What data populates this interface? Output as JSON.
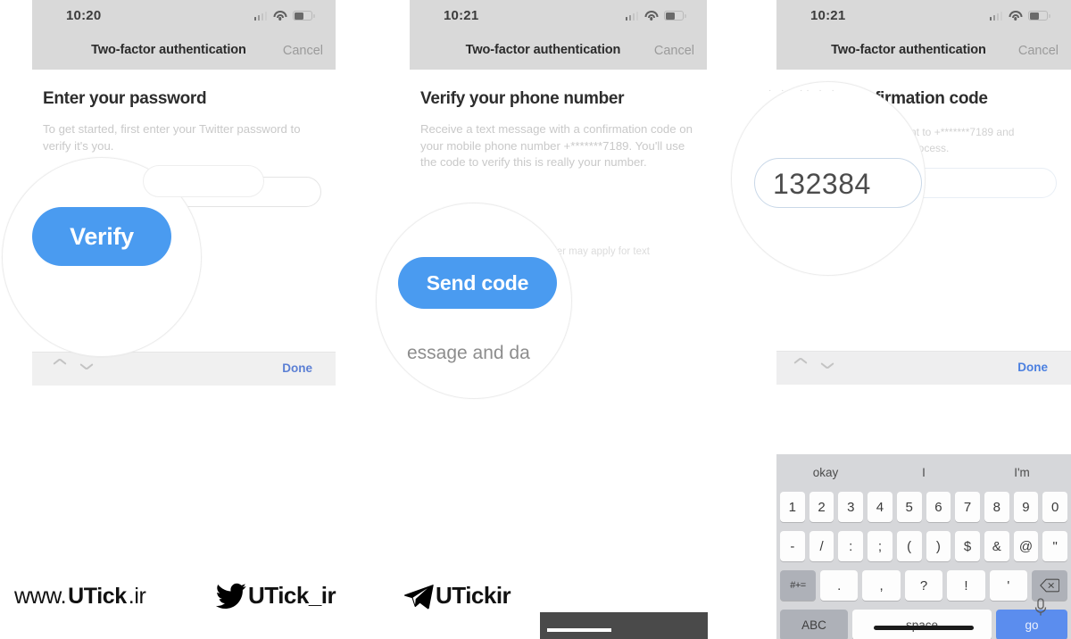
{
  "statusbar": {
    "time_p1": "10:20",
    "time_p2": "10:21",
    "time_p3": "10:21",
    "icons": [
      "signal-icon",
      "wifi-icon",
      "battery-icon"
    ]
  },
  "navbar": {
    "title": "Two-factor authentication",
    "cancel_label": "Cancel"
  },
  "panels": [
    {
      "id": "enter-password",
      "heading": "Enter your password",
      "body": "To get started, first enter your Twitter password to verify it's you.",
      "field_value": "",
      "accessory": {
        "done_label": "Done",
        "up_icon": "chevron-up-icon",
        "down_icon": "chevron-down-icon"
      },
      "magnifier": {
        "button_label": "Verify",
        "button_color": "#4a9bf0"
      }
    },
    {
      "id": "verify-phone",
      "heading": "Verify your phone number",
      "body": "Receive a text message with a confirmation code on your mobile phone number +*******7189. You'll use the code to verify this is really your number.",
      "fine_print": "Standard rates from your carrier may apply for text messages.",
      "magnifier": {
        "button_label": "Send code",
        "button_color": "#4a9bf0",
        "partial_text": "essage and da"
      }
    },
    {
      "id": "confirmation-code",
      "heading": "firmation code",
      "body_line1": "s sent to +*******7189 and",
      "body_line2": "the process.",
      "magnifier": {
        "code_value": "132384"
      },
      "accessory": {
        "done_label": "Done",
        "up_icon": "chevron-up-icon",
        "down_icon": "chevron-down-icon"
      },
      "keyboard": {
        "predictions": [
          "okay",
          "I",
          "I'm"
        ],
        "row_numbers": [
          "1",
          "2",
          "3",
          "4",
          "5",
          "6",
          "7",
          "8",
          "9",
          "0"
        ],
        "row_symbols": [
          "-",
          "/",
          ":",
          ";",
          "(",
          ")",
          "$",
          "&",
          "@",
          "\""
        ],
        "row_punct_modifier": "#+=",
        "row_punct": [
          ".",
          ",",
          "?",
          "!",
          "'"
        ],
        "backspace_icon": "backspace-icon",
        "abc_label": "ABC",
        "space_label": "space",
        "go_label": "go",
        "go_color": "#5b8dee",
        "mic_icon": "microphone-icon"
      }
    }
  ],
  "footer": {
    "website_prefix": "www.",
    "website_brand": "UTick",
    "website_suffix": ".ir",
    "twitter_icon": "twitter-bird-icon",
    "twitter_handle": "UTick_ir",
    "telegram_icon": "telegram-plane-icon",
    "telegram_handle": "UTickir"
  }
}
